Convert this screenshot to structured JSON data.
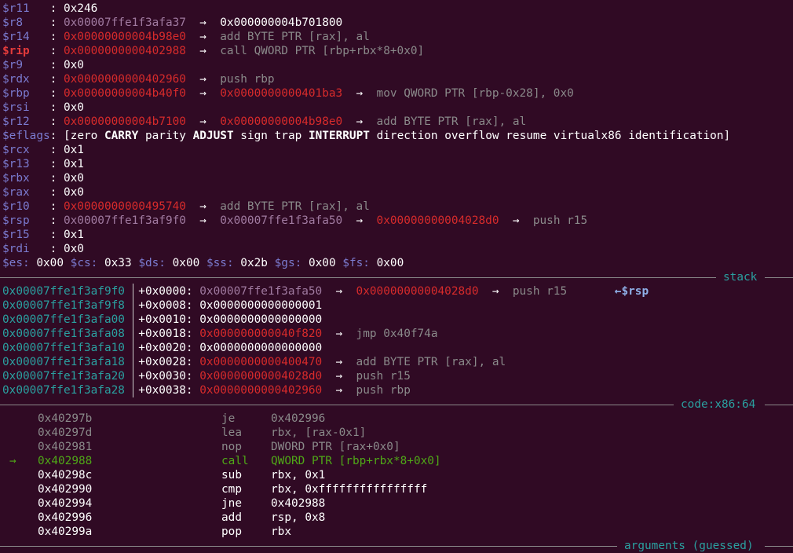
{
  "registers": [
    {
      "name": "$r11",
      "value": "0x246"
    },
    {
      "name": "$r8",
      "value": "0x00007ffe1f3afa37",
      "arrow": "→",
      "t1": "0x000000004b701800"
    },
    {
      "name": "$r14",
      "value": "0x00000000004b98e0",
      "arrow": "→",
      "t1": "add BYTE PTR [rax], al"
    },
    {
      "name": "$rip",
      "value": "0x0000000000402988",
      "arrow": "→",
      "t1": "call QWORD PTR [rbp+rbx*8+0x0]"
    },
    {
      "name": "$r9",
      "value": "0x0"
    },
    {
      "name": "$rdx",
      "value": "0x0000000000402960",
      "arrow": "→",
      "t1": "push rbp"
    },
    {
      "name": "$rbp",
      "value": "0x00000000004b40f0",
      "arrow": "→",
      "t1": "0x0000000000401ba3",
      "arrow2": "→",
      "t2": "mov QWORD PTR [rbp-0x28], 0x0"
    },
    {
      "name": "$rsi",
      "value": "0x0"
    },
    {
      "name": "$r12",
      "value": "0x00000000004b7100",
      "arrow": "→",
      "t1": "0x00000000004b98e0",
      "arrow2": "→",
      "t2": "add BYTE PTR [rax], al"
    },
    {
      "name": "$rcx",
      "value": "0x1"
    },
    {
      "name": "$r13",
      "value": "0x1"
    },
    {
      "name": "$rbx",
      "value": "0x0"
    },
    {
      "name": "$rax",
      "value": "0x0"
    },
    {
      "name": "$r10",
      "value": "0x0000000000495740",
      "arrow": "→",
      "t1": "add BYTE PTR [rax], al"
    },
    {
      "name": "$rsp",
      "value": "0x00007ffe1f3af9f0",
      "arrow": "→",
      "t1": "0x00007ffe1f3afa50",
      "arrow2": "→",
      "t2": "0x00000000004028d0",
      "arrow3": "→",
      "t3": "push r15"
    },
    {
      "name": "$r15",
      "value": "0x1"
    },
    {
      "name": "$rdi",
      "value": "0x0"
    }
  ],
  "eflags": {
    "name": "$eflags",
    "open": "[",
    "flags": [
      "zero",
      "CARRY",
      "parity",
      "ADJUST",
      "sign",
      "trap",
      "INTERRUPT",
      "direction",
      "overflow",
      "resume",
      "virtualx86",
      "identification"
    ],
    "close": "]"
  },
  "segments": [
    {
      "name": "$es:",
      "value": "0x00"
    },
    {
      "name": "$cs:",
      "value": "0x33"
    },
    {
      "name": "$ds:",
      "value": "0x00"
    },
    {
      "name": "$ss:",
      "value": "0x2b"
    },
    {
      "name": "$gs:",
      "value": "0x00"
    },
    {
      "name": "$fs:",
      "value": "0x00"
    }
  ],
  "stack_section": {
    "title": "stack"
  },
  "stack": [
    {
      "addr": "0x00007ffe1f3af9f0",
      "off": "+0x0000:",
      "val": "0x00007ffe1f3afa50",
      "arrow": "→",
      "t1": "0x00000000004028d0",
      "arrow2": "→",
      "t2": "push r15",
      "marker": "←$rsp"
    },
    {
      "addr": "0x00007ffe1f3af9f8",
      "off": "+0x0008:",
      "val": "0x0000000000000001"
    },
    {
      "addr": "0x00007ffe1f3afa00",
      "off": "+0x0010:",
      "val": "0x0000000000000000"
    },
    {
      "addr": "0x00007ffe1f3afa08",
      "off": "+0x0018:",
      "val": "0x000000000040f820",
      "arrow": "→",
      "t1": "jmp 0x40f74a"
    },
    {
      "addr": "0x00007ffe1f3afa10",
      "off": "+0x0020:",
      "val": "0x0000000000000000"
    },
    {
      "addr": "0x00007ffe1f3afa18",
      "off": "+0x0028:",
      "val": "0x0000000000400470",
      "arrow": "→",
      "t1": "add BYTE PTR [rax], al"
    },
    {
      "addr": "0x00007ffe1f3afa20",
      "off": "+0x0030:",
      "val": "0x00000000004028d0",
      "arrow": "→",
      "t1": "push r15"
    },
    {
      "addr": "0x00007ffe1f3afa28",
      "off": "+0x0038:",
      "val": "0x0000000000402960",
      "arrow": "→",
      "t1": "push rbp"
    }
  ],
  "code_section": {
    "title": "code:x86:64"
  },
  "code": [
    {
      "addr": "0x40297b",
      "mn": "je",
      "op": "0x402996"
    },
    {
      "addr": "0x40297d",
      "mn": "lea",
      "op": "rbx, [rax-0x1]"
    },
    {
      "addr": "0x402981",
      "mn": "nop",
      "op": "DWORD PTR [rax+0x0]"
    },
    {
      "addr": "0x402988",
      "mn": "call",
      "op": "QWORD PTR [rbp+rbx*8+0x0]",
      "current": true,
      "pointer": "→"
    },
    {
      "addr": "0x40298c",
      "mn": "sub",
      "op": "rbx, 0x1"
    },
    {
      "addr": "0x402990",
      "mn": "cmp",
      "op": "rbx, 0xffffffffffffffff"
    },
    {
      "addr": "0x402994",
      "mn": "jne",
      "op": "0x402988"
    },
    {
      "addr": "0x402996",
      "mn": "add",
      "op": "rsp, 0x8"
    },
    {
      "addr": "0x40299a",
      "mn": "pop",
      "op": "rbx"
    }
  ],
  "args_section": {
    "title": "arguments (guessed)"
  },
  "colors": {
    "background": "#300a24",
    "register": "#7b7bd0",
    "pointer_red": "#d72b2b",
    "rip": "#e33b3b",
    "gray": "#8a8a8a",
    "stack_addr": "#2aa0a0",
    "current_line": "#4fa817"
  }
}
